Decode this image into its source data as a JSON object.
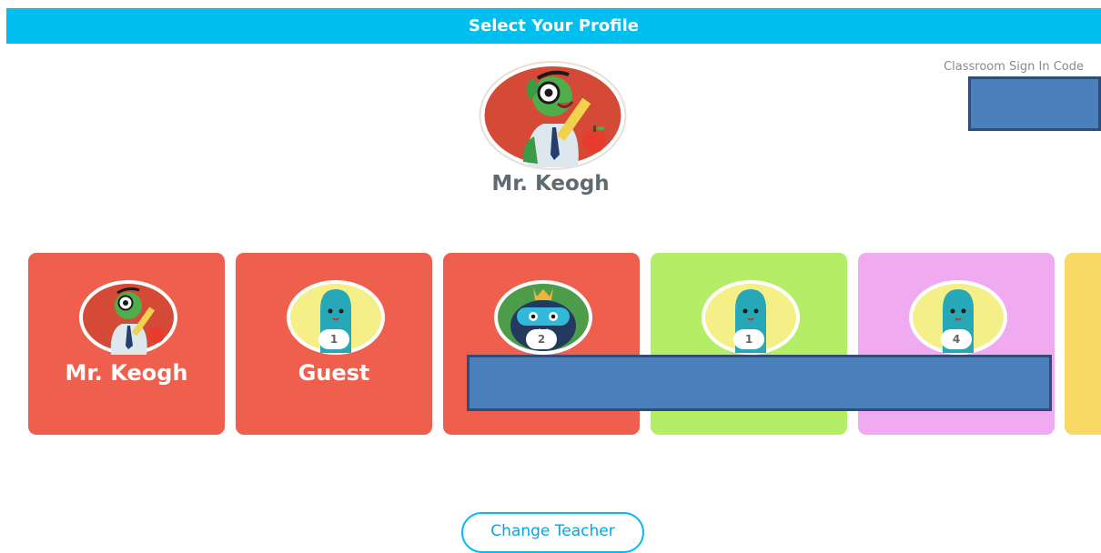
{
  "header": {
    "title": "Select Your Profile"
  },
  "classroom": {
    "sign_in_label": "Classroom Sign In Code"
  },
  "teacher": {
    "name": "Mr. Keogh",
    "avatar_icon": "bookworm-teacher-icon"
  },
  "profiles": [
    {
      "label": "Mr. Keogh",
      "badge": "",
      "color": "#ef5f4e",
      "avatar": "bookworm-teacher-icon"
    },
    {
      "label": "Guest",
      "badge": "1",
      "color": "#ef5f4e",
      "avatar": "blue-monster-icon"
    },
    {
      "label": "",
      "badge": "2",
      "color": "#ef5f4e",
      "avatar": "robot-monster-icon"
    },
    {
      "label": "",
      "badge": "1",
      "color": "#b4ee67",
      "avatar": "blue-monster-icon"
    },
    {
      "label": "",
      "badge": "4",
      "color": "#efaaf0",
      "avatar": "blue-monster-icon"
    },
    {
      "label": "",
      "badge": "",
      "color": "#f9d965",
      "avatar": ""
    }
  ],
  "footer": {
    "change_teacher_label": "Change Teacher"
  }
}
